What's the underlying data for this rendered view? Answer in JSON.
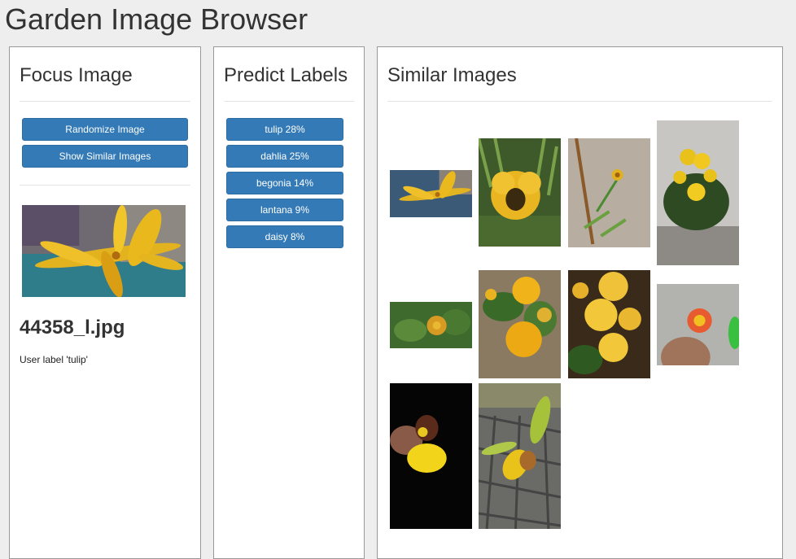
{
  "app": {
    "title": "Garden Image Browser"
  },
  "focus_panel": {
    "title": "Focus Image",
    "randomize_label": "Randomize Image",
    "show_similar_label": "Show Similar Images",
    "filename": "44358_l.jpg",
    "user_label": "User label 'tulip'"
  },
  "predict_panel": {
    "title": "Predict Labels",
    "labels": [
      "tulip 28%",
      "dahlia 25%",
      "begonia 14%",
      "lantana 9%",
      "daisy 8%"
    ]
  },
  "similar_panel": {
    "title": "Similar Images",
    "images": [
      "yellow-tulip-image",
      "yellow-pansy-image",
      "small-bud-image",
      "potted-marigold-image",
      "orange-lantana-image",
      "yellow-lantana-image",
      "yellow-begonia-image",
      "red-lantana-in-hand-image",
      "yellow-orchid-image",
      "green-orchid-image"
    ]
  },
  "colors": {
    "accent": "#337ab7",
    "panel_border": "#999999",
    "background": "#eeeeee"
  }
}
